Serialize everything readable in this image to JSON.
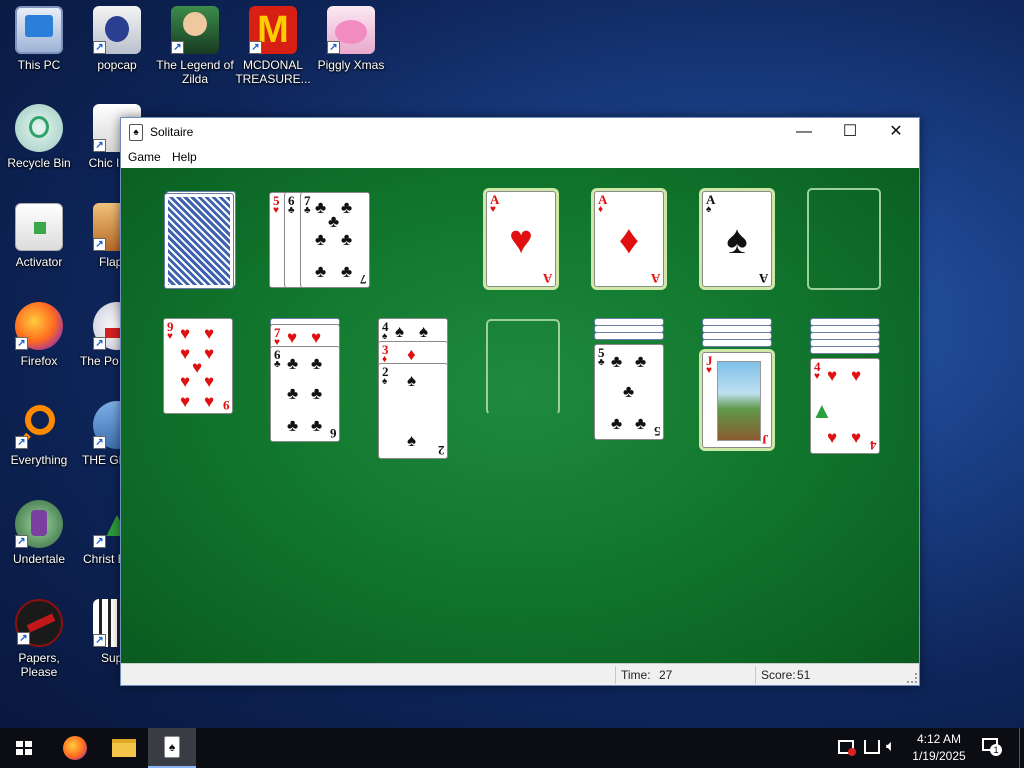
{
  "desktop": {
    "icons": [
      {
        "label": "This PC"
      },
      {
        "label": "popcap"
      },
      {
        "label": "The Legend of Zilda"
      },
      {
        "label": "MCDONAL TREASURE..."
      },
      {
        "label": "Piggly Xmas"
      },
      {
        "label": "Recycle Bin"
      },
      {
        "label": "Chic Invad"
      },
      {
        "label": "Activator"
      },
      {
        "label": "Flappy"
      },
      {
        "label": "Firefox"
      },
      {
        "label": "The Po Machi"
      },
      {
        "label": "Everything"
      },
      {
        "label": "THE GREEN"
      },
      {
        "label": "Undertale"
      },
      {
        "label": "Christ Brows"
      },
      {
        "label": "Papers, Please"
      },
      {
        "label": "Super"
      }
    ]
  },
  "window": {
    "title": "Solitaire",
    "controls": {
      "minimize": "—",
      "maximize": "☐",
      "close": "✕"
    },
    "menu": {
      "game": "Game",
      "help": "Help"
    },
    "status": {
      "time_label": "Time:",
      "time_value": "27",
      "score_label": "Score:",
      "score_value": "51"
    }
  },
  "game": {
    "waste": [
      {
        "rank": "5",
        "suit": "♥"
      },
      {
        "rank": "6",
        "suit": "♣"
      },
      {
        "rank": "7",
        "suit": "♣"
      }
    ],
    "foundations": [
      {
        "rank": "A",
        "suit": "♥"
      },
      {
        "rank": "A",
        "suit": "♦"
      },
      {
        "rank": "A",
        "suit": "♠"
      }
    ],
    "tableau": {
      "col1": [
        {
          "rank": "9",
          "suit": "♥"
        }
      ],
      "col2": [
        {
          "rank": "7",
          "suit": "♥"
        },
        {
          "rank": "6",
          "suit": "♣"
        }
      ],
      "col3": [
        {
          "rank": "4",
          "suit": "♠"
        },
        {
          "rank": "3",
          "suit": "♦"
        },
        {
          "rank": "2",
          "suit": "♠"
        }
      ],
      "col5": [
        {
          "rank": "5",
          "suit": "♣"
        }
      ],
      "col6": [
        {
          "rank": "J",
          "suit": "♥"
        }
      ],
      "col7": [
        {
          "rank": "4",
          "suit": "♥"
        }
      ]
    }
  },
  "taskbar": {
    "clock_time": "4:12 AM",
    "clock_date": "1/19/2025",
    "notification_count": "1"
  },
  "colors": {
    "felt": "#137a30",
    "red_suit": "#e01010",
    "card_back": "#3e62b0",
    "taskbar": "#0c0d12"
  }
}
